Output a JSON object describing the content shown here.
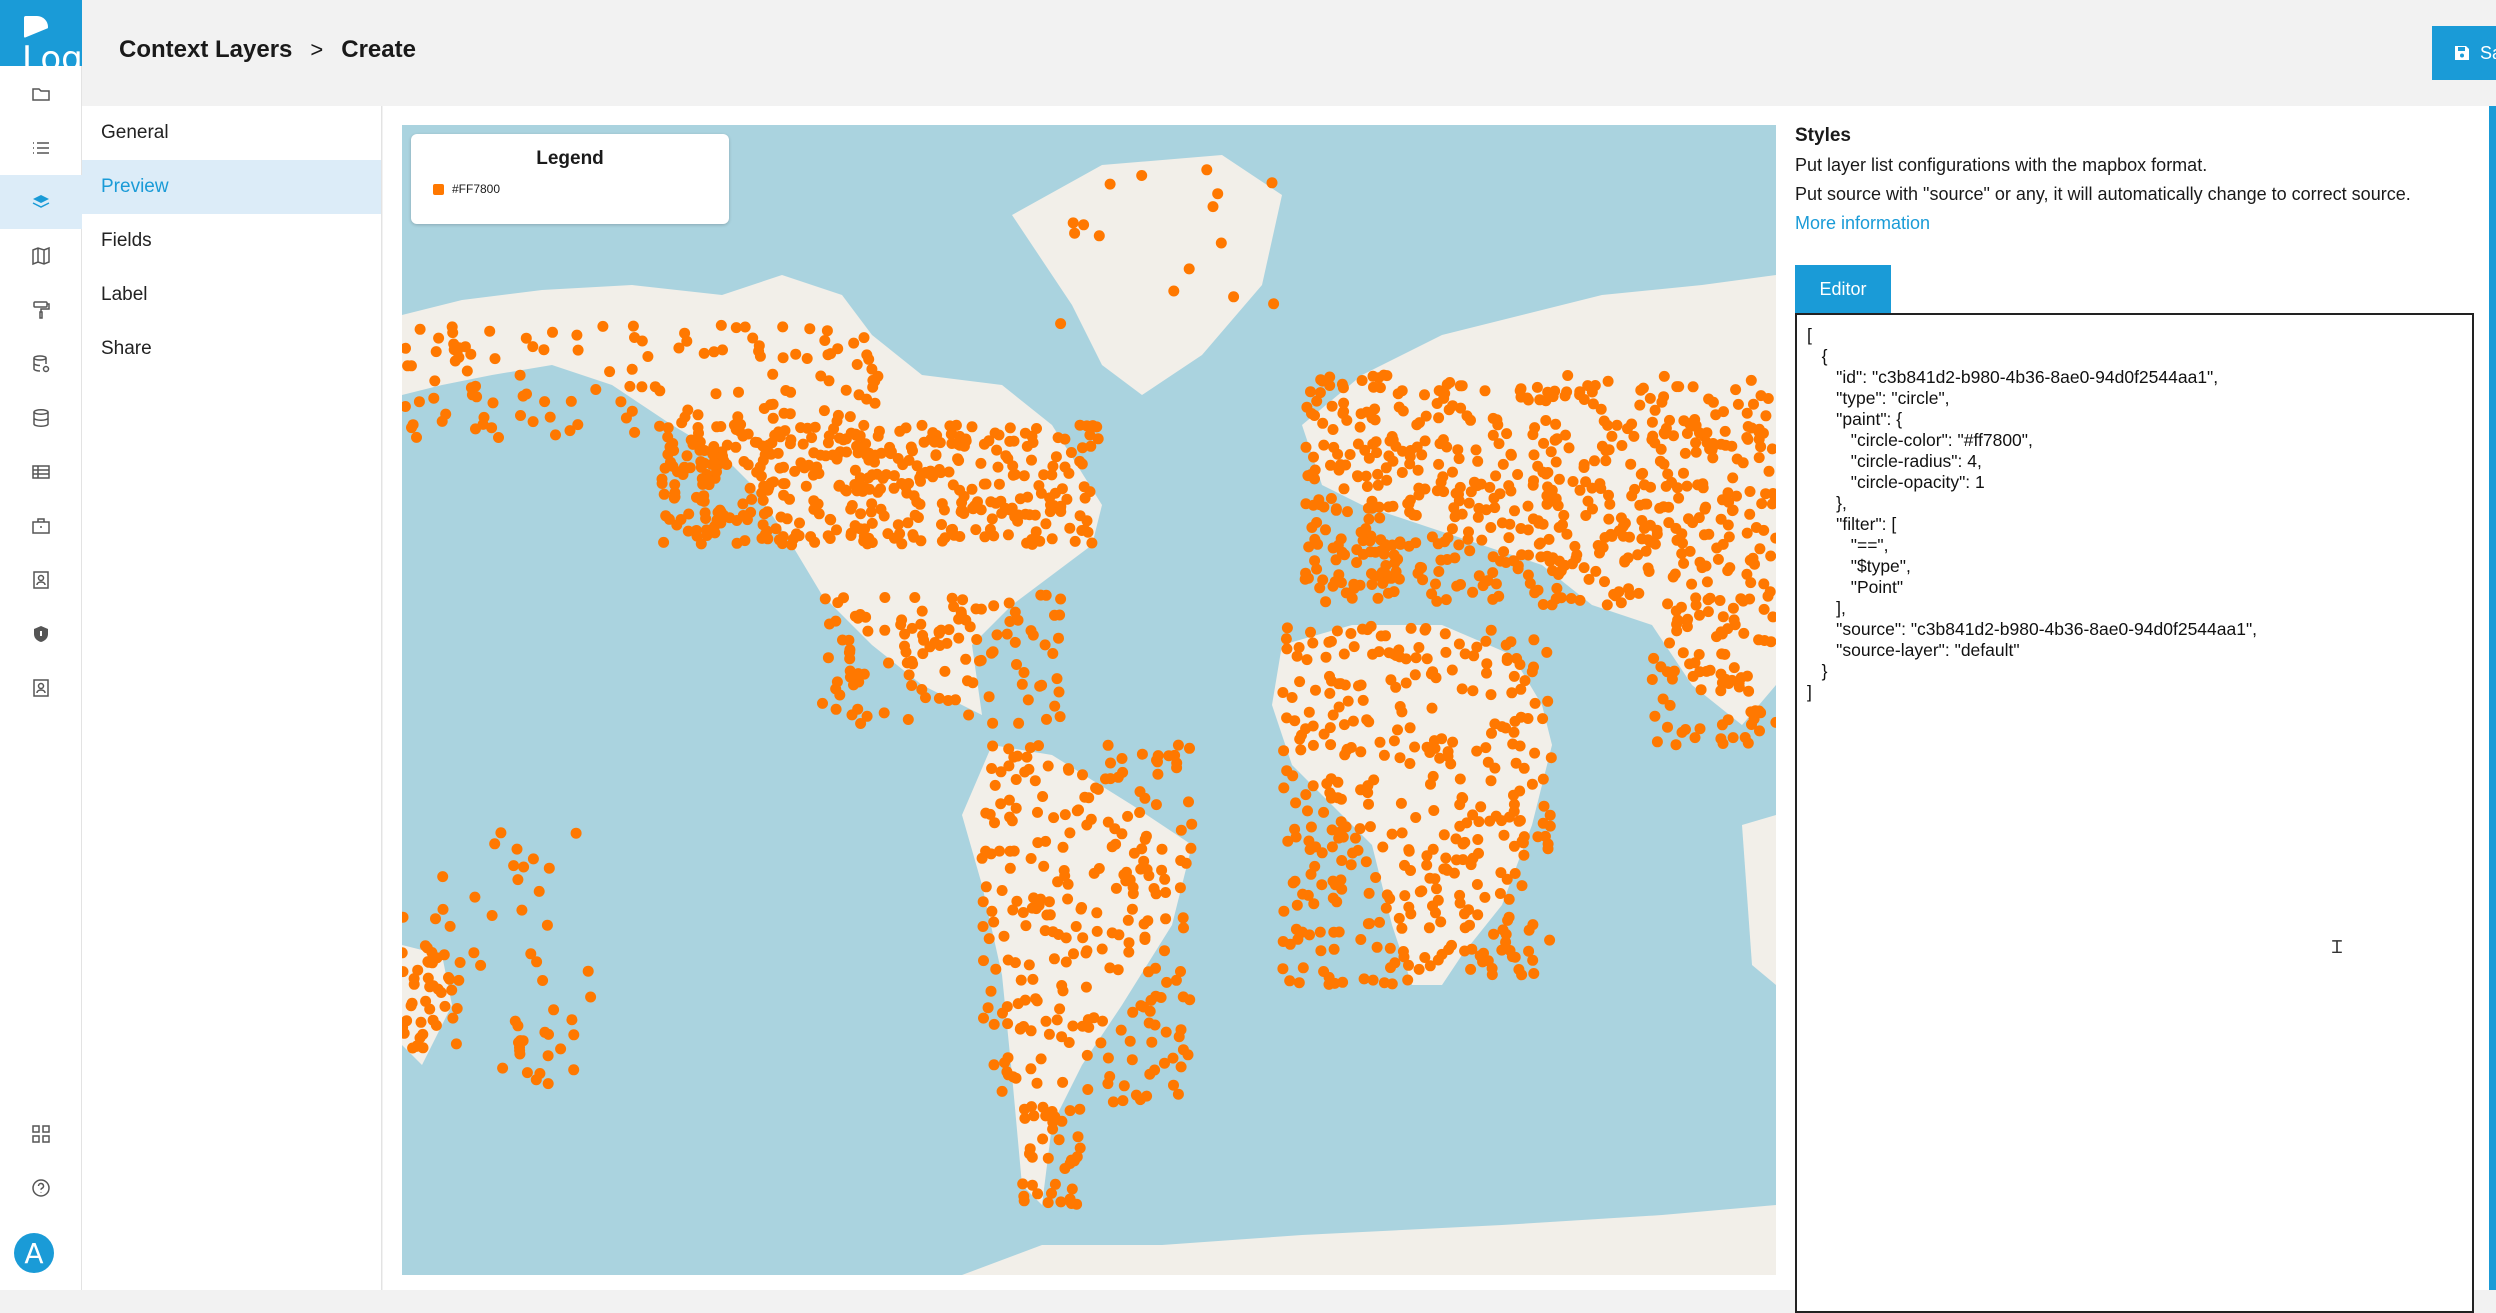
{
  "logo": {
    "text": "Logo"
  },
  "breadcrumb": {
    "parent": "Context Layers",
    "separator": ">",
    "current": "Create"
  },
  "toolbar": {
    "save_label": "Save"
  },
  "user": {
    "avatar_initial": "A"
  },
  "rail": {
    "items": [
      {
        "icon": "folder-icon"
      },
      {
        "icon": "list-icon"
      },
      {
        "icon": "layers-icon",
        "active": true
      },
      {
        "icon": "map-icon"
      },
      {
        "icon": "paint-roller-icon"
      },
      {
        "icon": "database-settings-icon"
      },
      {
        "icon": "database-icon"
      },
      {
        "icon": "table-icon"
      },
      {
        "icon": "briefcase-icon"
      },
      {
        "icon": "contact-card-icon"
      },
      {
        "icon": "shield-icon"
      },
      {
        "icon": "contact-book-icon"
      }
    ],
    "bottom": [
      {
        "icon": "apps-grid-icon"
      },
      {
        "icon": "help-icon"
      }
    ]
  },
  "subnav": {
    "items": [
      "General",
      "Preview",
      "Fields",
      "Label",
      "Share"
    ],
    "active": "Preview"
  },
  "legend": {
    "title": "Legend",
    "entry": "#FF7800",
    "color": "#ff7800"
  },
  "styles": {
    "title": "Styles",
    "desc1": "Put layer list configurations with the mapbox format.",
    "desc2": "Put source with \"source\" or any, it will automatically change to correct source.",
    "more_info": "More information",
    "editor_tab": "Editor",
    "code": "[\n   {\n      \"id\": \"c3b841d2-b980-4b36-8ae0-94d0f2544aa1\",\n      \"type\": \"circle\",\n      \"paint\": {\n         \"circle-color\": \"#ff7800\",\n         \"circle-radius\": 4,\n         \"circle-opacity\": 1\n      },\n      \"filter\": [\n         \"==\",\n         \"$type\",\n         \"Point\"\n      ],\n      \"source\": \"c3b841d2-b980-4b36-8ae0-94d0f2544aa1\",\n      \"source-layer\": \"default\"\n   }\n]"
  },
  "colors": {
    "accent": "#1a9bd7",
    "point": "#ff7800",
    "water": "#aad3df",
    "land": "#f2efe9"
  }
}
